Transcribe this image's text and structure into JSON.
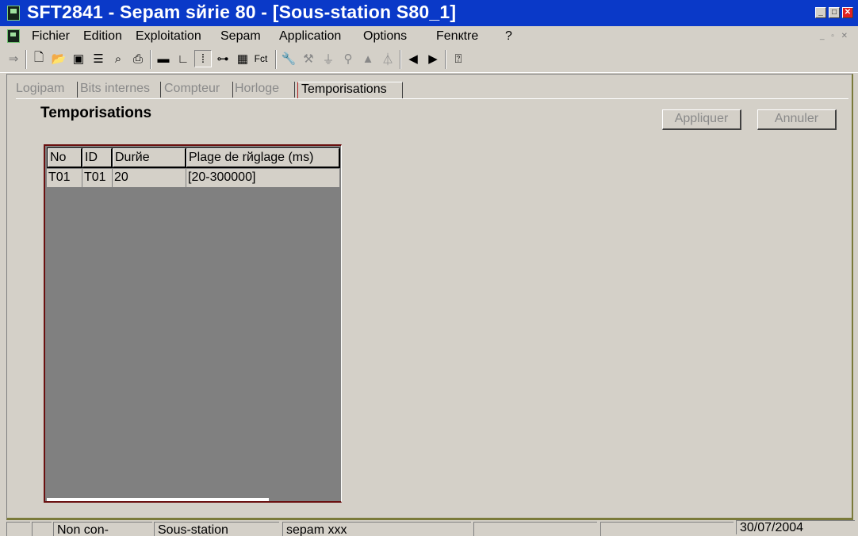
{
  "window": {
    "title": "SFT2841 - Sepam sйrie 80 - [Sous-station S80_1]"
  },
  "menu": [
    "Fichier",
    "Edition",
    "Exploitation",
    "Sepam",
    "Application",
    "Options",
    "Fenкtre",
    "?"
  ],
  "toolbar": {
    "fct_label": "Fct"
  },
  "tabs": [
    "Logipam",
    "Bits internes",
    "Compteur",
    "Horloge",
    "Temporisations"
  ],
  "page": {
    "heading": "Temporisations",
    "apply_label": "Appliquer",
    "cancel_label": "Annuler"
  },
  "table": {
    "columns": [
      "No",
      "ID",
      "Durйe",
      "Plage de rйglage (ms)"
    ],
    "rows": [
      [
        "T01",
        "T01",
        "20",
        "[20-300000]"
      ]
    ]
  },
  "statusbar": {
    "connection": "Non con-",
    "site": "Sous-station",
    "device": "sepam xxx",
    "date": "30/07/2004"
  }
}
